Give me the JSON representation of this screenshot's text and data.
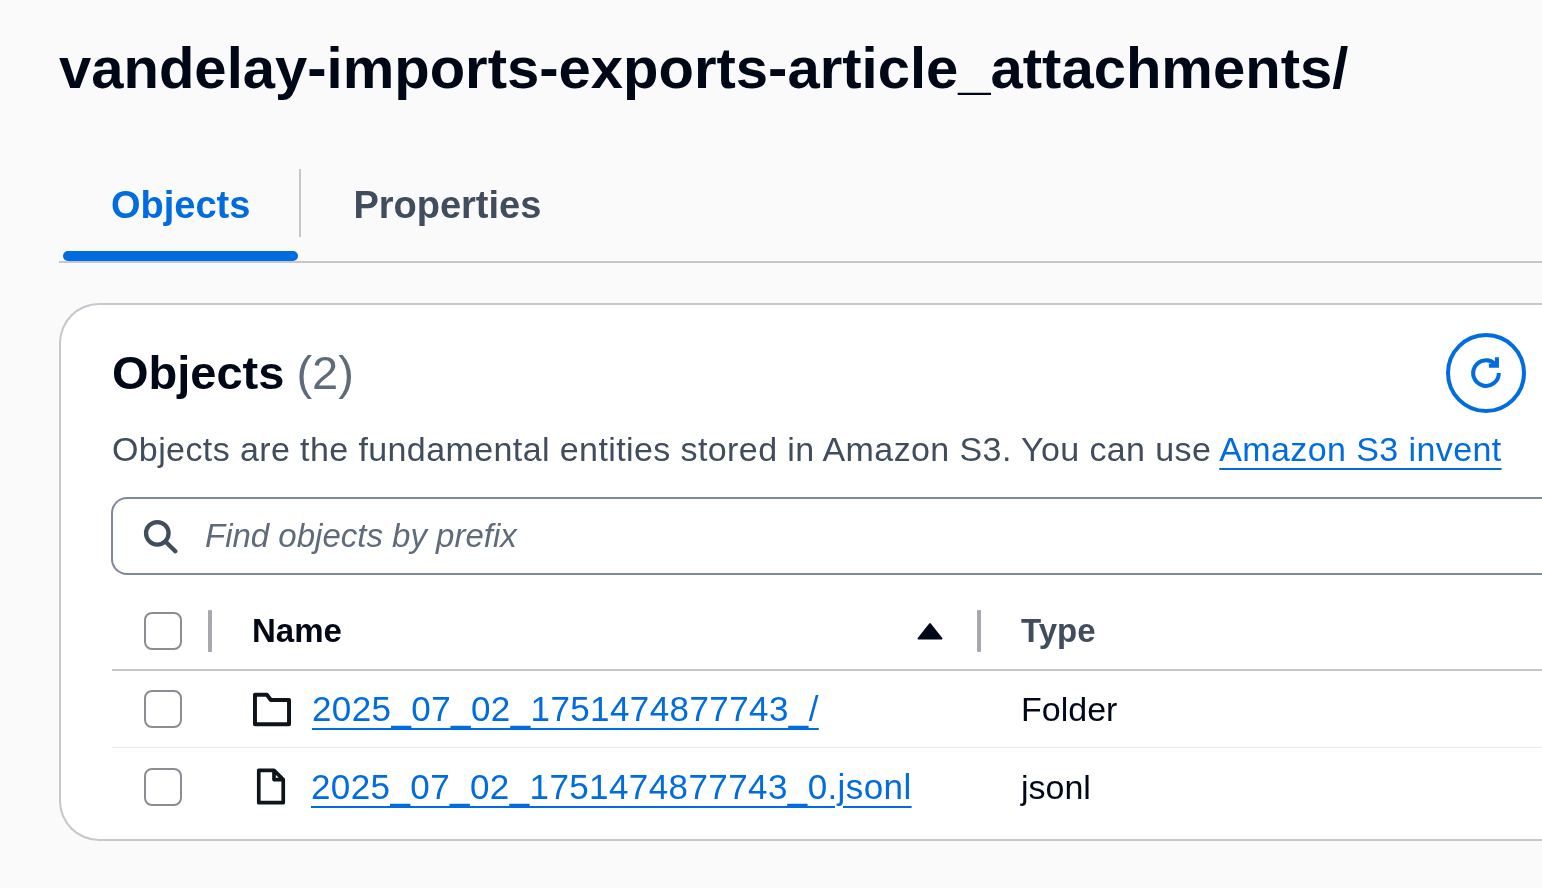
{
  "page": {
    "title": "vandelay-imports-exports-article_attachments/"
  },
  "tabs": [
    {
      "label": "Objects",
      "selected": true
    },
    {
      "label": "Properties",
      "selected": false
    }
  ],
  "objects_panel": {
    "heading": "Objects",
    "count": "(2)",
    "description": "Objects are the fundamental entities stored in Amazon S3. You can use ",
    "description_link": "Amazon S3 invent",
    "search": {
      "placeholder": "Find objects by prefix"
    },
    "table": {
      "select_all_checked": false,
      "columns": [
        {
          "label": "Name",
          "sorted": true
        },
        {
          "label": "Type",
          "sorted": false
        }
      ],
      "rows": [
        {
          "kind": "folder",
          "name": "2025_07_02_1751474877743_/",
          "type": "Folder",
          "checked": false
        },
        {
          "kind": "file",
          "name": "2025_07_02_1751474877743_0.jsonl",
          "type": "jsonl",
          "checked": false
        }
      ]
    }
  }
}
